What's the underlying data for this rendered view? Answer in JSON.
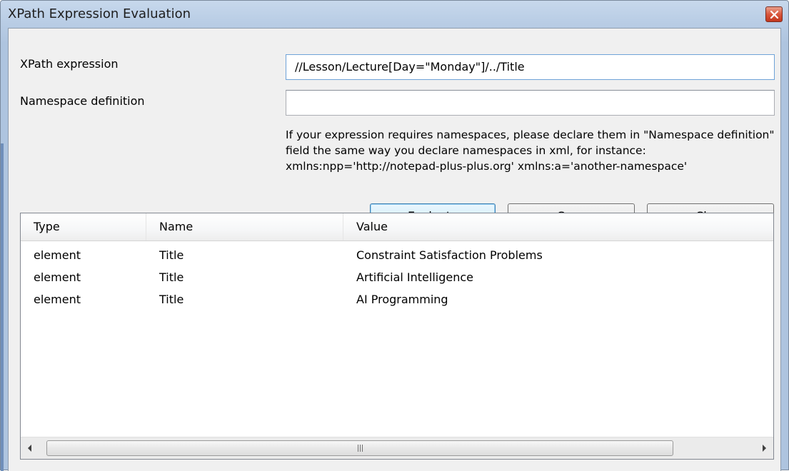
{
  "window": {
    "title": "XPath Expression Evaluation"
  },
  "form": {
    "xpath_label": "XPath expression",
    "xpath_value": "//Lesson/Lecture[Day=\"Monday\"]/../Title",
    "namespace_label": "Namespace definition",
    "namespace_value": "",
    "hint": "If your expression requires namespaces, please declare them in \"Namespace definition\" field the same way you declare namespaces in xml, for instance: xmlns:npp='http://notepad-plus-plus.org' xmlns:a='another-namespace'"
  },
  "buttons": {
    "evaluate": "Evaluate",
    "copy": "Copy",
    "clear": "Clear"
  },
  "results": {
    "columns": [
      "Type",
      "Name",
      "Value"
    ],
    "rows": [
      [
        "element",
        "Title",
        "Constraint Satisfaction Problems"
      ],
      [
        "element",
        "Title",
        "Artificial Intelligence"
      ],
      [
        "element",
        "Title",
        "AI Programming"
      ]
    ],
    "scroll_grip": "III"
  },
  "icons": {
    "close": "close-icon",
    "scroll_left": "arrow-left-icon",
    "scroll_right": "arrow-right-icon"
  },
  "colors": {
    "title_gradient": "#b9cde5",
    "close_button": "#d9563c",
    "default_button": "#bee6fd",
    "panel_bg": "#f0f0f0"
  }
}
